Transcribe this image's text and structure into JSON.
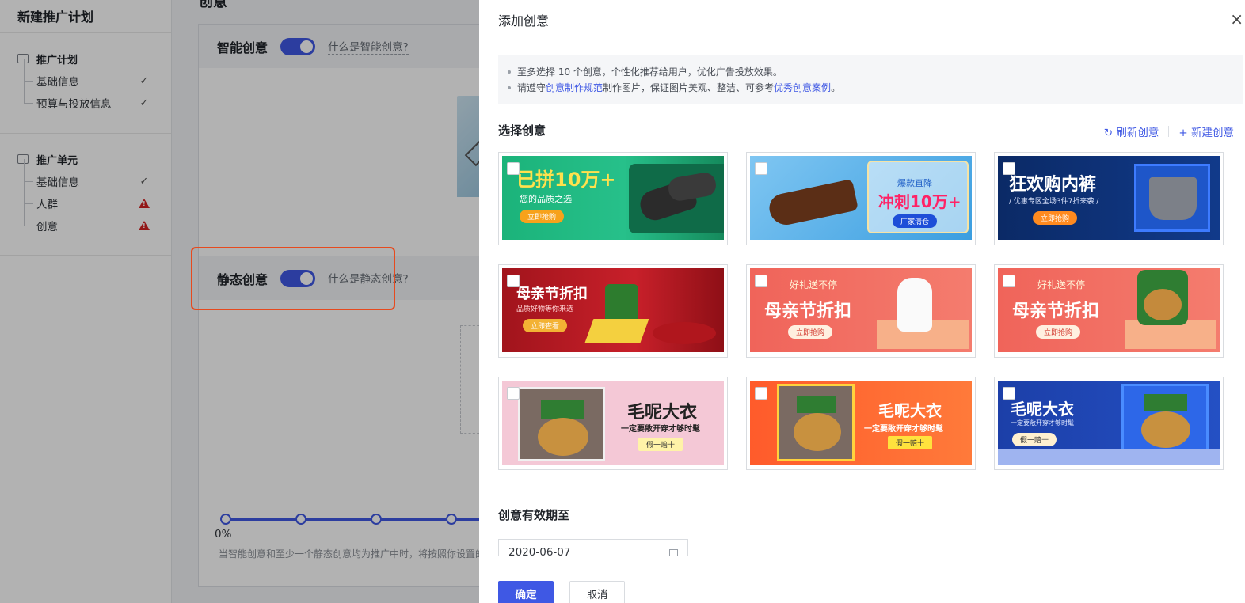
{
  "sidebar": {
    "title": "新建推广计划",
    "groups": [
      {
        "label": "推广计划",
        "items": [
          {
            "label": "基础信息",
            "status": "done"
          },
          {
            "label": "预算与投放信息",
            "status": "done"
          }
        ]
      },
      {
        "label": "推广单元",
        "items": [
          {
            "label": "基础信息",
            "status": "done"
          },
          {
            "label": "人群",
            "status": "error"
          },
          {
            "label": "创意",
            "status": "error"
          }
        ]
      }
    ]
  },
  "main": {
    "heading": "创意",
    "smart": {
      "title": "智能创意",
      "link": "什么是智能创意?"
    },
    "static": {
      "title": "静态创意",
      "link": "什么是静态创意?"
    },
    "slider": {
      "label": "0%"
    },
    "hint": "当智能创意和至少一个静态创意均为推广中时，将按照你设置的"
  },
  "drawer": {
    "title": "添加创意",
    "close_icon": "×",
    "notice": {
      "line1": "至多选择 10 个创意，个性化推荐给用户，优化广告投放效果。",
      "line2_a": "请遵守",
      "line2_link1": "创意制作规范",
      "line2_b": "制作图片，保证图片美观、整洁、可参考",
      "line2_link2": "优秀创意案例",
      "line2_c": "。"
    },
    "select_title": "选择创意",
    "refresh_label": "刷新创意",
    "new_label": "新建创意",
    "creatives": [
      {
        "headline": "已拼10万+",
        "sub": "您的品质之选",
        "cta": "立即抢购",
        "theme": "green"
      },
      {
        "headline": "冲刺10万+",
        "sub": "爆款直降",
        "cta": "厂家清仓",
        "theme": "blue"
      },
      {
        "headline": "狂欢购内裤",
        "sub": "/ 优惠专区全场3件7折来袭 /",
        "cta": "立即抢购",
        "theme": "navy"
      },
      {
        "headline": "母亲节折扣",
        "sub": "品质好物等你来选",
        "cta": "立即查看",
        "theme": "red"
      },
      {
        "headline": "母亲节折扣",
        "sub": "好礼送不停",
        "cta": "立即抢购",
        "theme": "coral"
      },
      {
        "headline": "母亲节折扣",
        "sub": "好礼送不停",
        "cta": "立即抢购",
        "theme": "coral2"
      },
      {
        "headline": "毛呢大衣",
        "sub": "一定要敞开穿才够时髦",
        "cta": "假一赔十",
        "theme": "pink"
      },
      {
        "headline": "毛呢大衣",
        "sub": "一定要敞开穿才够时髦",
        "cta": "假一赔十",
        "theme": "orange"
      },
      {
        "headline": "毛呢大衣",
        "sub": "一定要敞开穿才够时髦",
        "cta": "假一赔十",
        "theme": "royal"
      }
    ],
    "date_title": "创意有效期至",
    "date_value": "2020-06-07",
    "ok_label": "确定",
    "cancel_label": "取消"
  },
  "colors": {
    "primary": "#3f58e4",
    "error": "#d32222",
    "highlight": "#e64a1e"
  }
}
